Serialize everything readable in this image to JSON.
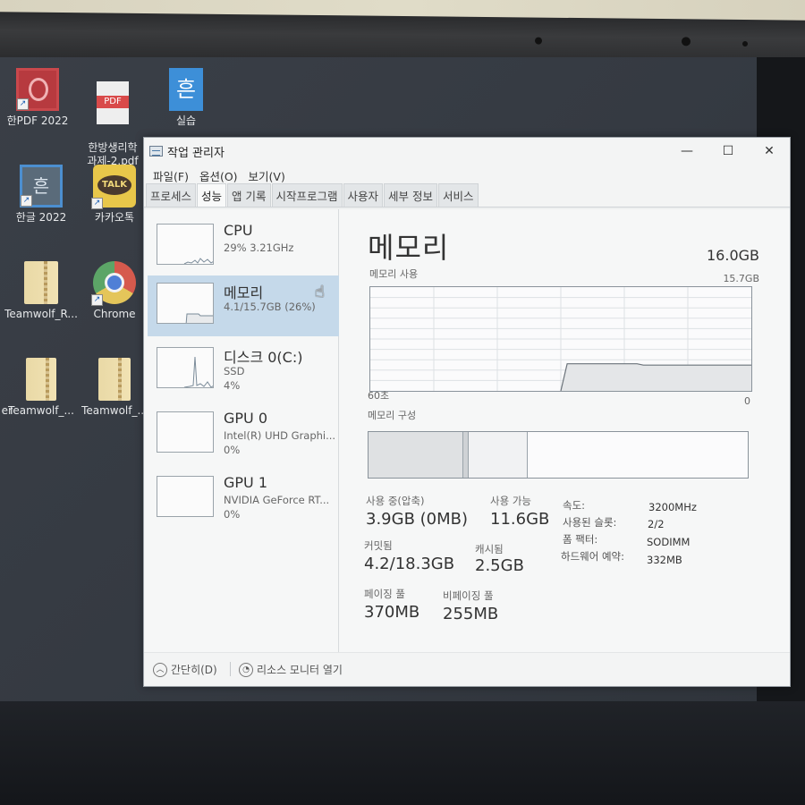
{
  "desktop": {
    "icons": [
      {
        "label": "한PDF 2022",
        "icon": "hanpdf-icon"
      },
      {
        "label": "한방생리학\n과제-2.pdf",
        "icon": "pdf-file-icon"
      },
      {
        "label": "실습",
        "icon": "hwp-file-icon"
      },
      {
        "label": "한글 2022",
        "icon": "hangul-icon"
      },
      {
        "label": "카카오톡",
        "icon": "kakaotalk-icon"
      },
      {
        "label": "Teamwolf_R...",
        "icon": "zip-folder-icon"
      },
      {
        "label": "Chrome",
        "icon": "chrome-icon"
      },
      {
        "label": "Teamwolf_...",
        "icon": "zip-folder-icon"
      },
      {
        "label": "Teamwolf_...",
        "icon": "zip-folder-icon"
      },
      {
        "label": "er",
        "icon": "partial-icon"
      }
    ],
    "kakaotalk_badge": "TALK",
    "pdf_badge": "PDF",
    "hwp_glyph": "흔"
  },
  "window": {
    "title": "작업 관리자",
    "controls": {
      "minimize": "—",
      "maximize": "☐",
      "close": "✕"
    },
    "menu": [
      "파일(F)",
      "옵션(O)",
      "보기(V)"
    ],
    "tabs": [
      {
        "label": "프로세스",
        "active": false
      },
      {
        "label": "성능",
        "active": true
      },
      {
        "label": "앱 기록",
        "active": false
      },
      {
        "label": "시작프로그램",
        "active": false
      },
      {
        "label": "사용자",
        "active": false
      },
      {
        "label": "세부 정보",
        "active": false
      },
      {
        "label": "서비스",
        "active": false
      }
    ]
  },
  "sidebar": {
    "items": [
      {
        "name": "CPU",
        "line1": "29% 3.21GHz",
        "line2": "",
        "selected": false
      },
      {
        "name": "메모리",
        "line1": "4.1/15.7GB (26%)",
        "line2": "",
        "selected": true
      },
      {
        "name": "디스크 0(C:)",
        "line1": "SSD",
        "line2": "4%",
        "selected": false
      },
      {
        "name": "GPU 0",
        "line1": "Intel(R) UHD Graphi...",
        "line2": "0%",
        "selected": false
      },
      {
        "name": "GPU 1",
        "line1": "NVIDIA GeForce RT...",
        "line2": "0%",
        "selected": false
      }
    ]
  },
  "memory": {
    "title": "메모리",
    "total": "16.0GB",
    "usage_label": "메모리 사용",
    "graph_max": "15.7GB",
    "graph_left": "60초",
    "graph_right": "0",
    "usage_series_gb": [
      0,
      0,
      0,
      0,
      0,
      0,
      0,
      0,
      0,
      0,
      0,
      0,
      0,
      0,
      0,
      0,
      0,
      0,
      0,
      0,
      0,
      0,
      0,
      0,
      0,
      0,
      0,
      0,
      0,
      0,
      0,
      4.1,
      4.1,
      4.1,
      4.1,
      4.1,
      4.1,
      4.1,
      4.1,
      4.1,
      4.1,
      4.1,
      4.1,
      3.9,
      3.9,
      3.9,
      3.9,
      3.9,
      3.9,
      3.9,
      3.9,
      3.9,
      3.9,
      3.9,
      3.9,
      3.9,
      3.9,
      3.9,
      3.9,
      3.9,
      3.9
    ],
    "composition_label": "메모리 구성",
    "composition_fractions": {
      "in_use": 0.25,
      "modified": 0.015,
      "standby": 0.155,
      "free": 0.58
    },
    "stats": {
      "in_use_label": "사용 중(압축)",
      "in_use_value": "3.9GB (0MB)",
      "available_label": "사용 가능",
      "available_value": "11.6GB",
      "committed_label": "커밋됨",
      "committed_value": "4.2/18.3GB",
      "cached_label": "캐시됨",
      "cached_value": "2.5GB",
      "paged_label": "페이징 풀",
      "paged_value": "370MB",
      "nonpaged_label": "비페이징 풀",
      "nonpaged_value": "255MB"
    },
    "specs": [
      {
        "label": "속도:",
        "value": "3200MHz"
      },
      {
        "label": "사용된 슬롯:",
        "value": "2/2"
      },
      {
        "label": "폼 팩터:",
        "value": "SODIMM"
      },
      {
        "label": "하드웨어 예약:",
        "value": "332MB"
      }
    ]
  },
  "footer": {
    "fewer_details": "간단히(D)",
    "resource_monitor": "리소스 모니터 열기"
  },
  "colors": {
    "selected_bg": "#c5d9ea",
    "graph_line": "#6b737a",
    "graph_fill": "#e4e6e8"
  }
}
